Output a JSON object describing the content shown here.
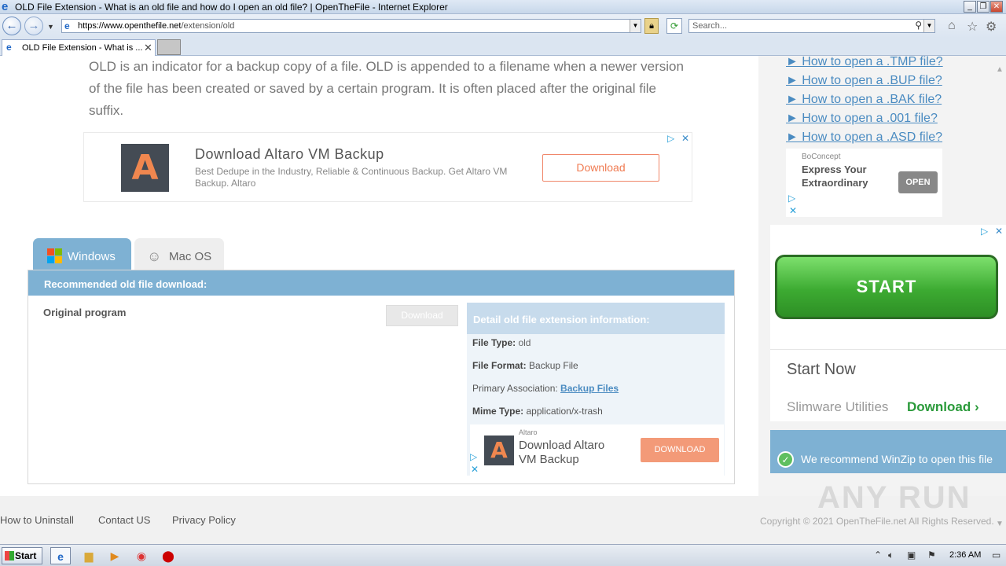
{
  "window": {
    "title": "OLD File Extension - What is an old file and how do I open an old file? | OpenTheFile - Internet Explorer",
    "minimize": "_",
    "restore": "❐",
    "close": "✕"
  },
  "address": {
    "url_prefix": "https://www.",
    "url_host": "openthefile.net",
    "url_path": "/extension/old",
    "search_placeholder": "Search..."
  },
  "tabs": [
    {
      "label": "OLD File Extension - What is ..."
    }
  ],
  "page": {
    "description": "OLD is an indicator for a backup copy of a file. OLD is appended to a filename when a newer version of the file has been created or saved by a certain program. It is often placed after the original file suffix.",
    "ad1": {
      "title": "Download Altaro VM Backup",
      "body": "Best Dedupe in the Industry, Reliable & Continuous Backup. Get Altaro VM Backup. Altaro",
      "button": "Download"
    },
    "os_tabs": [
      "Windows",
      "Mac OS"
    ],
    "recommended_header": "Recommended old file download:",
    "original_program": "Original program",
    "download_disabled": "Download",
    "detail": {
      "header": "Detail old file extension information:",
      "file_type_label": "File Type:",
      "file_type": "old",
      "file_format_label": "File Format:",
      "file_format": "Backup File",
      "primary_assoc_label": "Primary Association:",
      "primary_assoc": "Backup Files",
      "mime_label": "Mime Type:",
      "mime": "application/x-trash"
    },
    "ad2": {
      "brand": "Altaro",
      "title": "Download Altaro VM Backup",
      "button": "DOWNLOAD"
    }
  },
  "sidebar": {
    "howto_links": [
      "► How to open a .TMP file?",
      "► How to open a .BUP file?",
      "► How to open a .BAK file?",
      "► How to open a .001 file?",
      "► How to open a .ASD file?"
    ],
    "ad3": {
      "brand": "BoConcept",
      "title": "Express Your Extraordinary",
      "button": "OPEN"
    },
    "ad4": {
      "start": "START",
      "start_now": "Start Now",
      "company": "Slimware Utilities",
      "download": "Download"
    },
    "winzip": "We recommend WinZip to open this file"
  },
  "footer": {
    "links": [
      "How to Uninstall",
      "Contact US",
      "Privacy Policy"
    ],
    "copyright": "Copyright © 2021 OpenTheFile.net All Rights Reserved."
  },
  "watermark": "ANY RUN",
  "taskbar": {
    "start": "Start",
    "clock": "2:36 AM"
  },
  "colors": {
    "accent_blue": "#7eb1d3",
    "link_blue": "#4a8bc1",
    "ad_orange": "#f39a78",
    "start_green": "#3dab32"
  }
}
